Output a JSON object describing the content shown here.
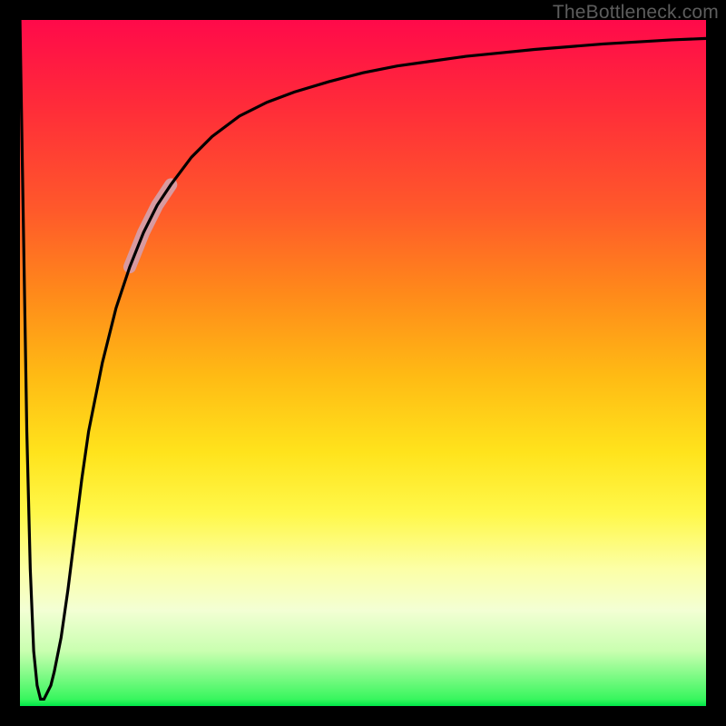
{
  "attribution": "TheBottleneck.com",
  "chart_data": {
    "type": "line",
    "title": "",
    "xlabel": "",
    "ylabel": "",
    "xlim": [
      0,
      100
    ],
    "ylim": [
      0,
      100
    ],
    "grid": false,
    "legend": false,
    "series": [
      {
        "name": "bottleneck-curve",
        "x": [
          0.0,
          0.5,
          1.0,
          1.5,
          2.0,
          2.5,
          3.0,
          3.5,
          4.0,
          4.5,
          5.0,
          6.0,
          7.0,
          8.0,
          9.0,
          10.0,
          12.0,
          14.0,
          16.0,
          18.0,
          20.0,
          22.0,
          25.0,
          28.0,
          32.0,
          36.0,
          40.0,
          45.0,
          50.0,
          55.0,
          60.0,
          65.0,
          70.0,
          75.0,
          80.0,
          85.0,
          90.0,
          95.0,
          100.0
        ],
        "y": [
          100.0,
          70.0,
          40.0,
          20.0,
          8.0,
          3.0,
          1.0,
          1.0,
          2.0,
          3.0,
          5.0,
          10.0,
          17.0,
          25.0,
          33.0,
          40.0,
          50.0,
          58.0,
          64.0,
          69.0,
          73.0,
          76.0,
          80.0,
          83.0,
          86.0,
          88.0,
          89.5,
          91.0,
          92.3,
          93.3,
          94.0,
          94.7,
          95.2,
          95.7,
          96.1,
          96.5,
          96.8,
          97.1,
          97.3
        ]
      }
    ],
    "highlight_segment": {
      "series": "bottleneck-curve",
      "x_start": 16.0,
      "x_end": 22.0,
      "color": "#d89aa0",
      "stroke_width_px": 14
    }
  }
}
